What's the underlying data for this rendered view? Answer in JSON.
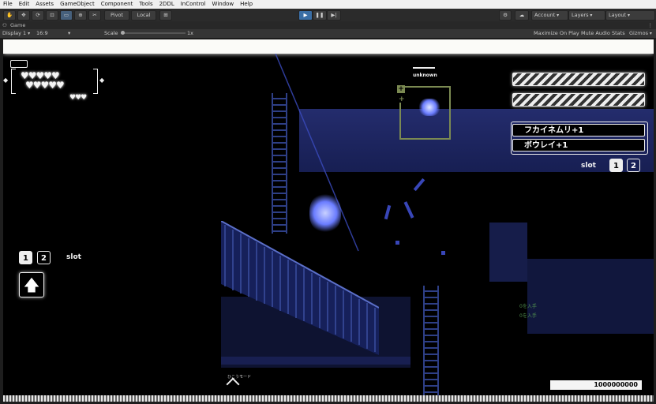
{
  "menu": [
    "File",
    "Edit",
    "Assets",
    "GameObject",
    "Component",
    "Tools",
    "2DDL",
    "InControl",
    "Window",
    "Help"
  ],
  "toolbar": {
    "pivot": "Pivot",
    "local": "Local",
    "account": "Account",
    "layers": "Layers",
    "layout": "Layout"
  },
  "game_tab": {
    "title": "Game"
  },
  "game_bar": {
    "display": "Display 1",
    "aspect": "16:9 Aspect",
    "scale_label": "Scale",
    "scale_value": "1x",
    "maximize": "Maximize On Play",
    "mute": "Mute Audio",
    "stats": "Stats",
    "gizmos": "Gizmos"
  },
  "hud": {
    "target_label": "unknown",
    "skills": [
      "フカイネムリ+1",
      "ボウレイ+1"
    ],
    "slot_label_right": "slot",
    "slot_label_left": "slot",
    "slot_numbers": [
      "1",
      "2"
    ],
    "info_lines": [
      "0を入手",
      "0を入手"
    ],
    "mode_label": "ひこうモード",
    "score": "1000000000"
  }
}
